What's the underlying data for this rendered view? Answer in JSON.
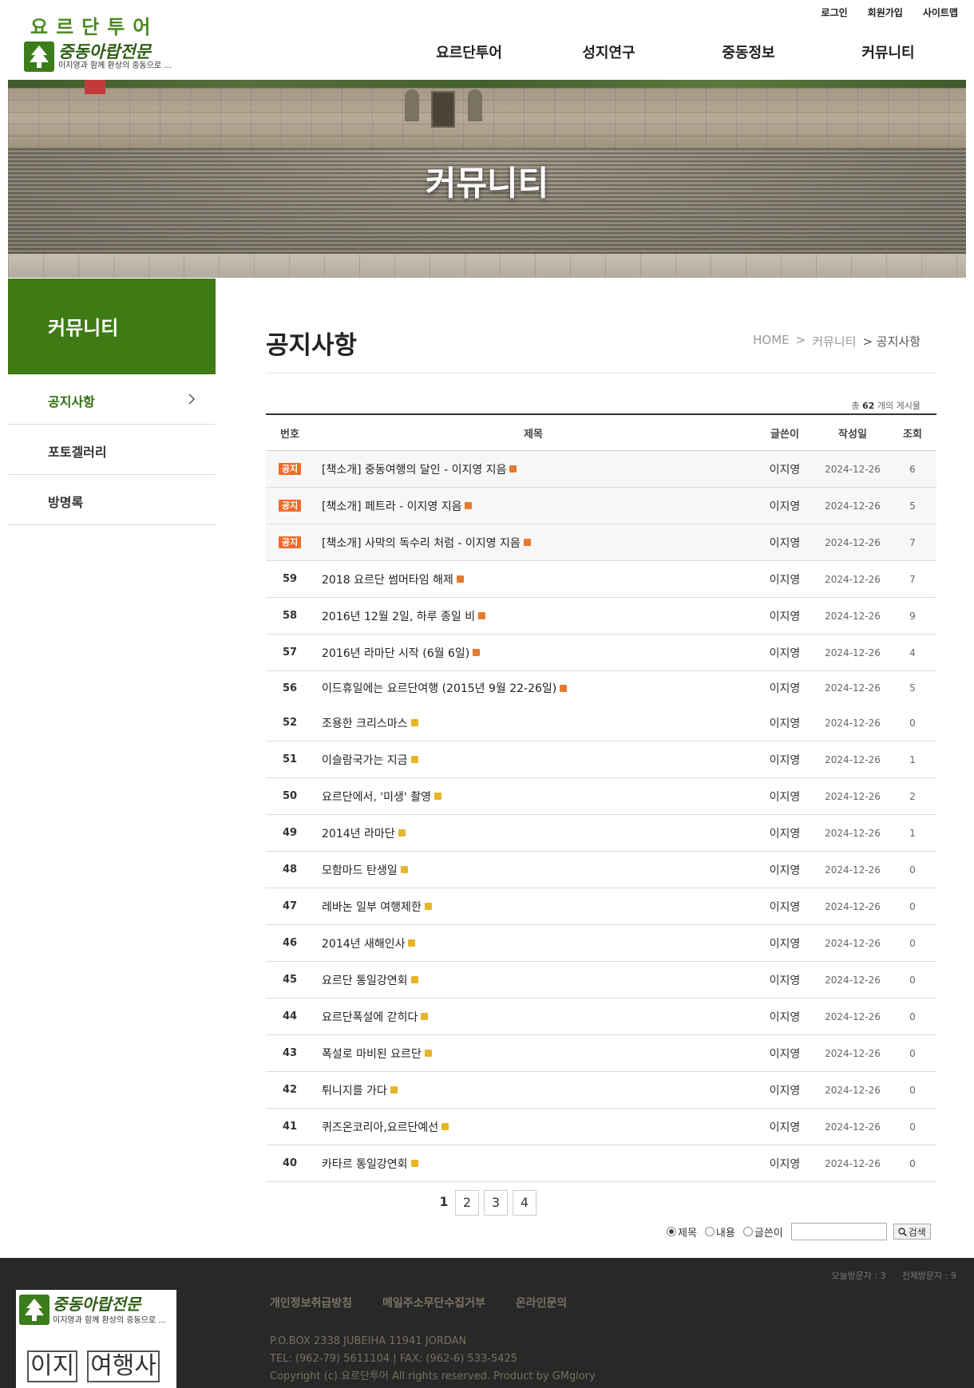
{
  "header": {
    "logo_top": "요르단투어",
    "logo_brand": "중동아랍전문",
    "logo_slogan": "이지영과 함께 환상의 중동으로 ...",
    "util": [
      "로그인",
      "회원가입",
      "사이트맵"
    ],
    "gnb": [
      "요르단투어",
      "성지연구",
      "중동정보",
      "커뮤니티"
    ]
  },
  "hero": {
    "title": "커뮤니티"
  },
  "sidebar": {
    "title": "커뮤니티",
    "items": [
      {
        "label": "공지사항",
        "active": true
      },
      {
        "label": "포토겔러리",
        "active": false
      },
      {
        "label": "방명록",
        "active": false
      }
    ]
  },
  "content": {
    "title": "공지사항",
    "breadcrumb": [
      "HOME",
      ">",
      "커뮤니티",
      "> 공지사항"
    ],
    "total_prefix": "총",
    "total_count": "62",
    "total_suffix": "개의 게시물"
  },
  "board": {
    "headers": {
      "no": "번호",
      "title": "제목",
      "writer": "글쓴이",
      "date": "작성일",
      "hit": "조회"
    },
    "notice_label": "공지",
    "rows": [
      {
        "no": "공지",
        "notice": true,
        "title": "[책소개] 중동여행의 달인 - 이지영 지음",
        "writer": "이지영",
        "date": "2024-12-26",
        "hit": "6"
      },
      {
        "no": "공지",
        "notice": true,
        "title": "[책소개] 페트라 - 이지영 지음",
        "writer": "이지영",
        "date": "2024-12-26",
        "hit": "5"
      },
      {
        "no": "공지",
        "notice": true,
        "title": "[책소개] 사막의 독수리 처럼 - 이지영 지음",
        "writer": "이지영",
        "date": "2024-12-26",
        "hit": "7"
      },
      {
        "no": "59",
        "notice": false,
        "title": "2018 요르단 썸머타임 해제",
        "writer": "이지영",
        "date": "2024-12-26",
        "hit": "7"
      },
      {
        "no": "58",
        "notice": false,
        "title": "2016년 12월 2일, 하루 종일 비",
        "writer": "이지영",
        "date": "2024-12-26",
        "hit": "9"
      },
      {
        "no": "57",
        "notice": false,
        "title": "2016년 라마단 시작 (6월 6일)",
        "writer": "이지영",
        "date": "2024-12-26",
        "hit": "4"
      },
      {
        "no": "56",
        "notice": false,
        "title": "이드휴일에는 요르단여행 (2015년 9월 22-26일)",
        "writer": "이지영",
        "date": "2024-12-26",
        "hit": "5"
      },
      {
        "no": "52",
        "notice": false,
        "title": "조용한 크리스마스",
        "writer": "이지영",
        "date": "2024-12-26",
        "hit": "0"
      },
      {
        "no": "51",
        "notice": false,
        "title": "이슬람국가는 지금",
        "writer": "이지영",
        "date": "2024-12-26",
        "hit": "1"
      },
      {
        "no": "50",
        "notice": false,
        "title": "요르단에서, '미생' 촬영",
        "writer": "이지영",
        "date": "2024-12-26",
        "hit": "2"
      },
      {
        "no": "49",
        "notice": false,
        "title": "2014년 라마단",
        "writer": "이지영",
        "date": "2024-12-26",
        "hit": "1"
      },
      {
        "no": "48",
        "notice": false,
        "title": "모함마드 탄생일",
        "writer": "이지영",
        "date": "2024-12-26",
        "hit": "0"
      },
      {
        "no": "47",
        "notice": false,
        "title": "레바논 일부 여행제한",
        "writer": "이지영",
        "date": "2024-12-26",
        "hit": "0"
      },
      {
        "no": "46",
        "notice": false,
        "title": "2014년 새해인사",
        "writer": "이지영",
        "date": "2024-12-26",
        "hit": "0"
      },
      {
        "no": "45",
        "notice": false,
        "title": "요르단 통일강연회",
        "writer": "이지영",
        "date": "2024-12-26",
        "hit": "0"
      },
      {
        "no": "44",
        "notice": false,
        "title": "요르단폭설에 갇히다",
        "writer": "이지영",
        "date": "2024-12-26",
        "hit": "0"
      },
      {
        "no": "43",
        "notice": false,
        "title": "폭설로 마비된 요르단",
        "writer": "이지영",
        "date": "2024-12-26",
        "hit": "0"
      },
      {
        "no": "42",
        "notice": false,
        "title": "튀니지를 가다",
        "writer": "이지영",
        "date": "2024-12-26",
        "hit": "0"
      },
      {
        "no": "41",
        "notice": false,
        "title": "퀴즈온코리아,요르단예선",
        "writer": "이지영",
        "date": "2024-12-26",
        "hit": "0"
      },
      {
        "no": "40",
        "notice": false,
        "title": "카타르 통일강연회",
        "writer": "이지영",
        "date": "2024-12-26",
        "hit": "0"
      }
    ]
  },
  "pagination": {
    "pages": [
      "1",
      "2",
      "3",
      "4"
    ],
    "current": "1"
  },
  "search": {
    "options": [
      "제목",
      "내용",
      "글쓴이"
    ],
    "selected": "제목",
    "value": "",
    "button": "검색"
  },
  "footer": {
    "visit_today": "오늘방문자 : 3",
    "visit_total": "전체방문자 : 9",
    "logo_brand": "중동아랍전문",
    "logo_slogan": "이지영과 함께 환상의 중동으로 ...",
    "logo_sub": [
      "이지",
      "여행사"
    ],
    "links": [
      "개인정보취급방침",
      "메일주소무단수집거부",
      "온라인문의"
    ],
    "address": "P.O.BOX 2338 JUBEIHA 11941 JORDAN",
    "phone": "TEL: (962-79) 5611104  |  FAX: (962-6) 533-5425",
    "copyright": "Copyright (c) 요르단투어 All rights reserved.    Product by GMglory"
  },
  "colors": {
    "brand_green": "#3f7b14",
    "notice_badge": "#f06b2b",
    "footer_bg": "#282828"
  }
}
